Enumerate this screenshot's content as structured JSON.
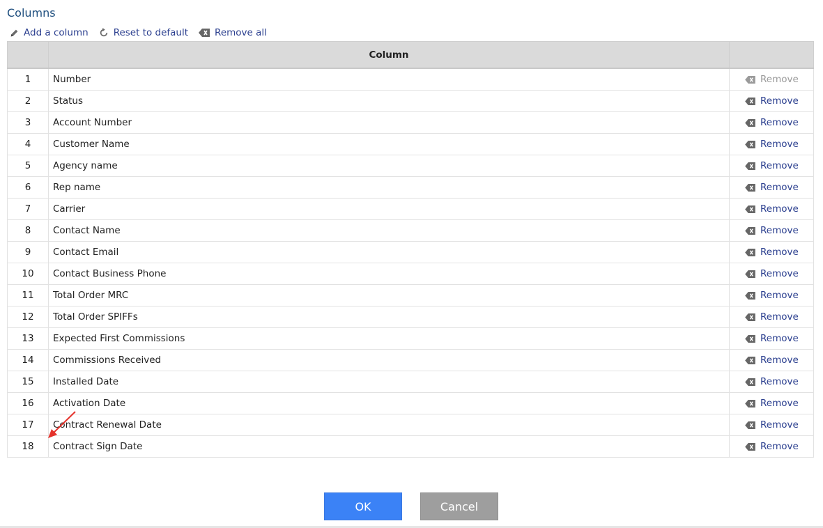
{
  "title": "Columns",
  "toolbar": {
    "add": "Add a column",
    "reset": "Reset to default",
    "remove_all": "Remove all"
  },
  "table": {
    "header": "Column",
    "remove_label": "Remove",
    "rows": [
      {
        "num": "1",
        "name": "Number",
        "remove_enabled": false
      },
      {
        "num": "2",
        "name": "Status",
        "remove_enabled": true
      },
      {
        "num": "3",
        "name": "Account Number",
        "remove_enabled": true
      },
      {
        "num": "4",
        "name": "Customer Name",
        "remove_enabled": true
      },
      {
        "num": "5",
        "name": "Agency name",
        "remove_enabled": true
      },
      {
        "num": "6",
        "name": "Rep name",
        "remove_enabled": true
      },
      {
        "num": "7",
        "name": "Carrier",
        "remove_enabled": true
      },
      {
        "num": "8",
        "name": "Contact Name",
        "remove_enabled": true
      },
      {
        "num": "9",
        "name": "Contact Email",
        "remove_enabled": true
      },
      {
        "num": "10",
        "name": "Contact Business Phone",
        "remove_enabled": true
      },
      {
        "num": "11",
        "name": "Total Order MRC",
        "remove_enabled": true
      },
      {
        "num": "12",
        "name": "Total Order SPIFFs",
        "remove_enabled": true
      },
      {
        "num": "13",
        "name": "Expected First Commissions",
        "remove_enabled": true
      },
      {
        "num": "14",
        "name": "Commissions Received",
        "remove_enabled": true
      },
      {
        "num": "15",
        "name": "Installed Date",
        "remove_enabled": true
      },
      {
        "num": "16",
        "name": "Activation Date",
        "remove_enabled": true
      },
      {
        "num": "17",
        "name": "Contract Renewal Date",
        "remove_enabled": true
      },
      {
        "num": "18",
        "name": "Contract Sign Date",
        "remove_enabled": true
      }
    ]
  },
  "buttons": {
    "ok": "OK",
    "cancel": "Cancel"
  },
  "colors": {
    "accent": "#3b82f6",
    "link": "#2b3f8f",
    "annotation": "#e5322b"
  }
}
